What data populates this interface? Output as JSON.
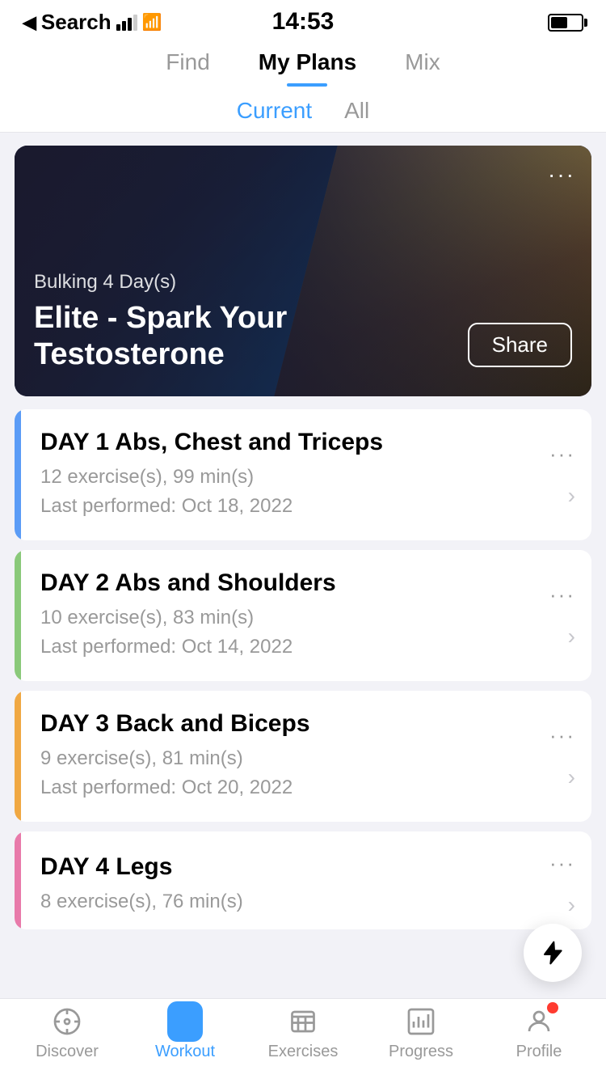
{
  "statusBar": {
    "carrier": "Search",
    "time": "14:53"
  },
  "navTabs": {
    "items": [
      {
        "id": "find",
        "label": "Find",
        "active": false
      },
      {
        "id": "myplans",
        "label": "My Plans",
        "active": true
      },
      {
        "id": "mix",
        "label": "Mix",
        "active": false
      }
    ]
  },
  "subTabs": {
    "items": [
      {
        "id": "current",
        "label": "Current",
        "active": true
      },
      {
        "id": "all",
        "label": "All",
        "active": false
      }
    ]
  },
  "heroCard": {
    "subtitle": "Bulking  4 Day(s)",
    "title": "Elite - Spark Your Testosterone",
    "moreLabel": "···",
    "shareLabel": "Share"
  },
  "dayCards": [
    {
      "id": "day1",
      "title": "DAY 1 Abs, Chest and Triceps",
      "exercises": "12 exercise(s), 99 min(s)",
      "lastPerformed": "Last performed: Oct 18, 2022",
      "accentColor": "#5b9cf6",
      "moreLabel": "···"
    },
    {
      "id": "day2",
      "title": "DAY 2 Abs and Shoulders",
      "exercises": "10 exercise(s), 83 min(s)",
      "lastPerformed": "Last performed: Oct 14, 2022",
      "accentColor": "#8ac97a",
      "moreLabel": "···"
    },
    {
      "id": "day3",
      "title": "DAY 3 Back and Biceps",
      "exercises": "9 exercise(s), 81 min(s)",
      "lastPerformed": "Last performed: Oct 20, 2022",
      "accentColor": "#f0a843",
      "moreLabel": "···"
    },
    {
      "id": "day4",
      "title": "DAY 4 Legs",
      "exercises": "8 exercise(s), 76 min(s)",
      "lastPerformed": "",
      "accentColor": "#e87aaa",
      "moreLabel": "···"
    }
  ],
  "bottomTabs": [
    {
      "id": "discover",
      "label": "Discover",
      "active": false
    },
    {
      "id": "workout",
      "label": "Workout",
      "active": true
    },
    {
      "id": "exercises",
      "label": "Exercises",
      "active": false
    },
    {
      "id": "progress",
      "label": "Progress",
      "active": false
    },
    {
      "id": "profile",
      "label": "Profile",
      "active": false
    }
  ]
}
